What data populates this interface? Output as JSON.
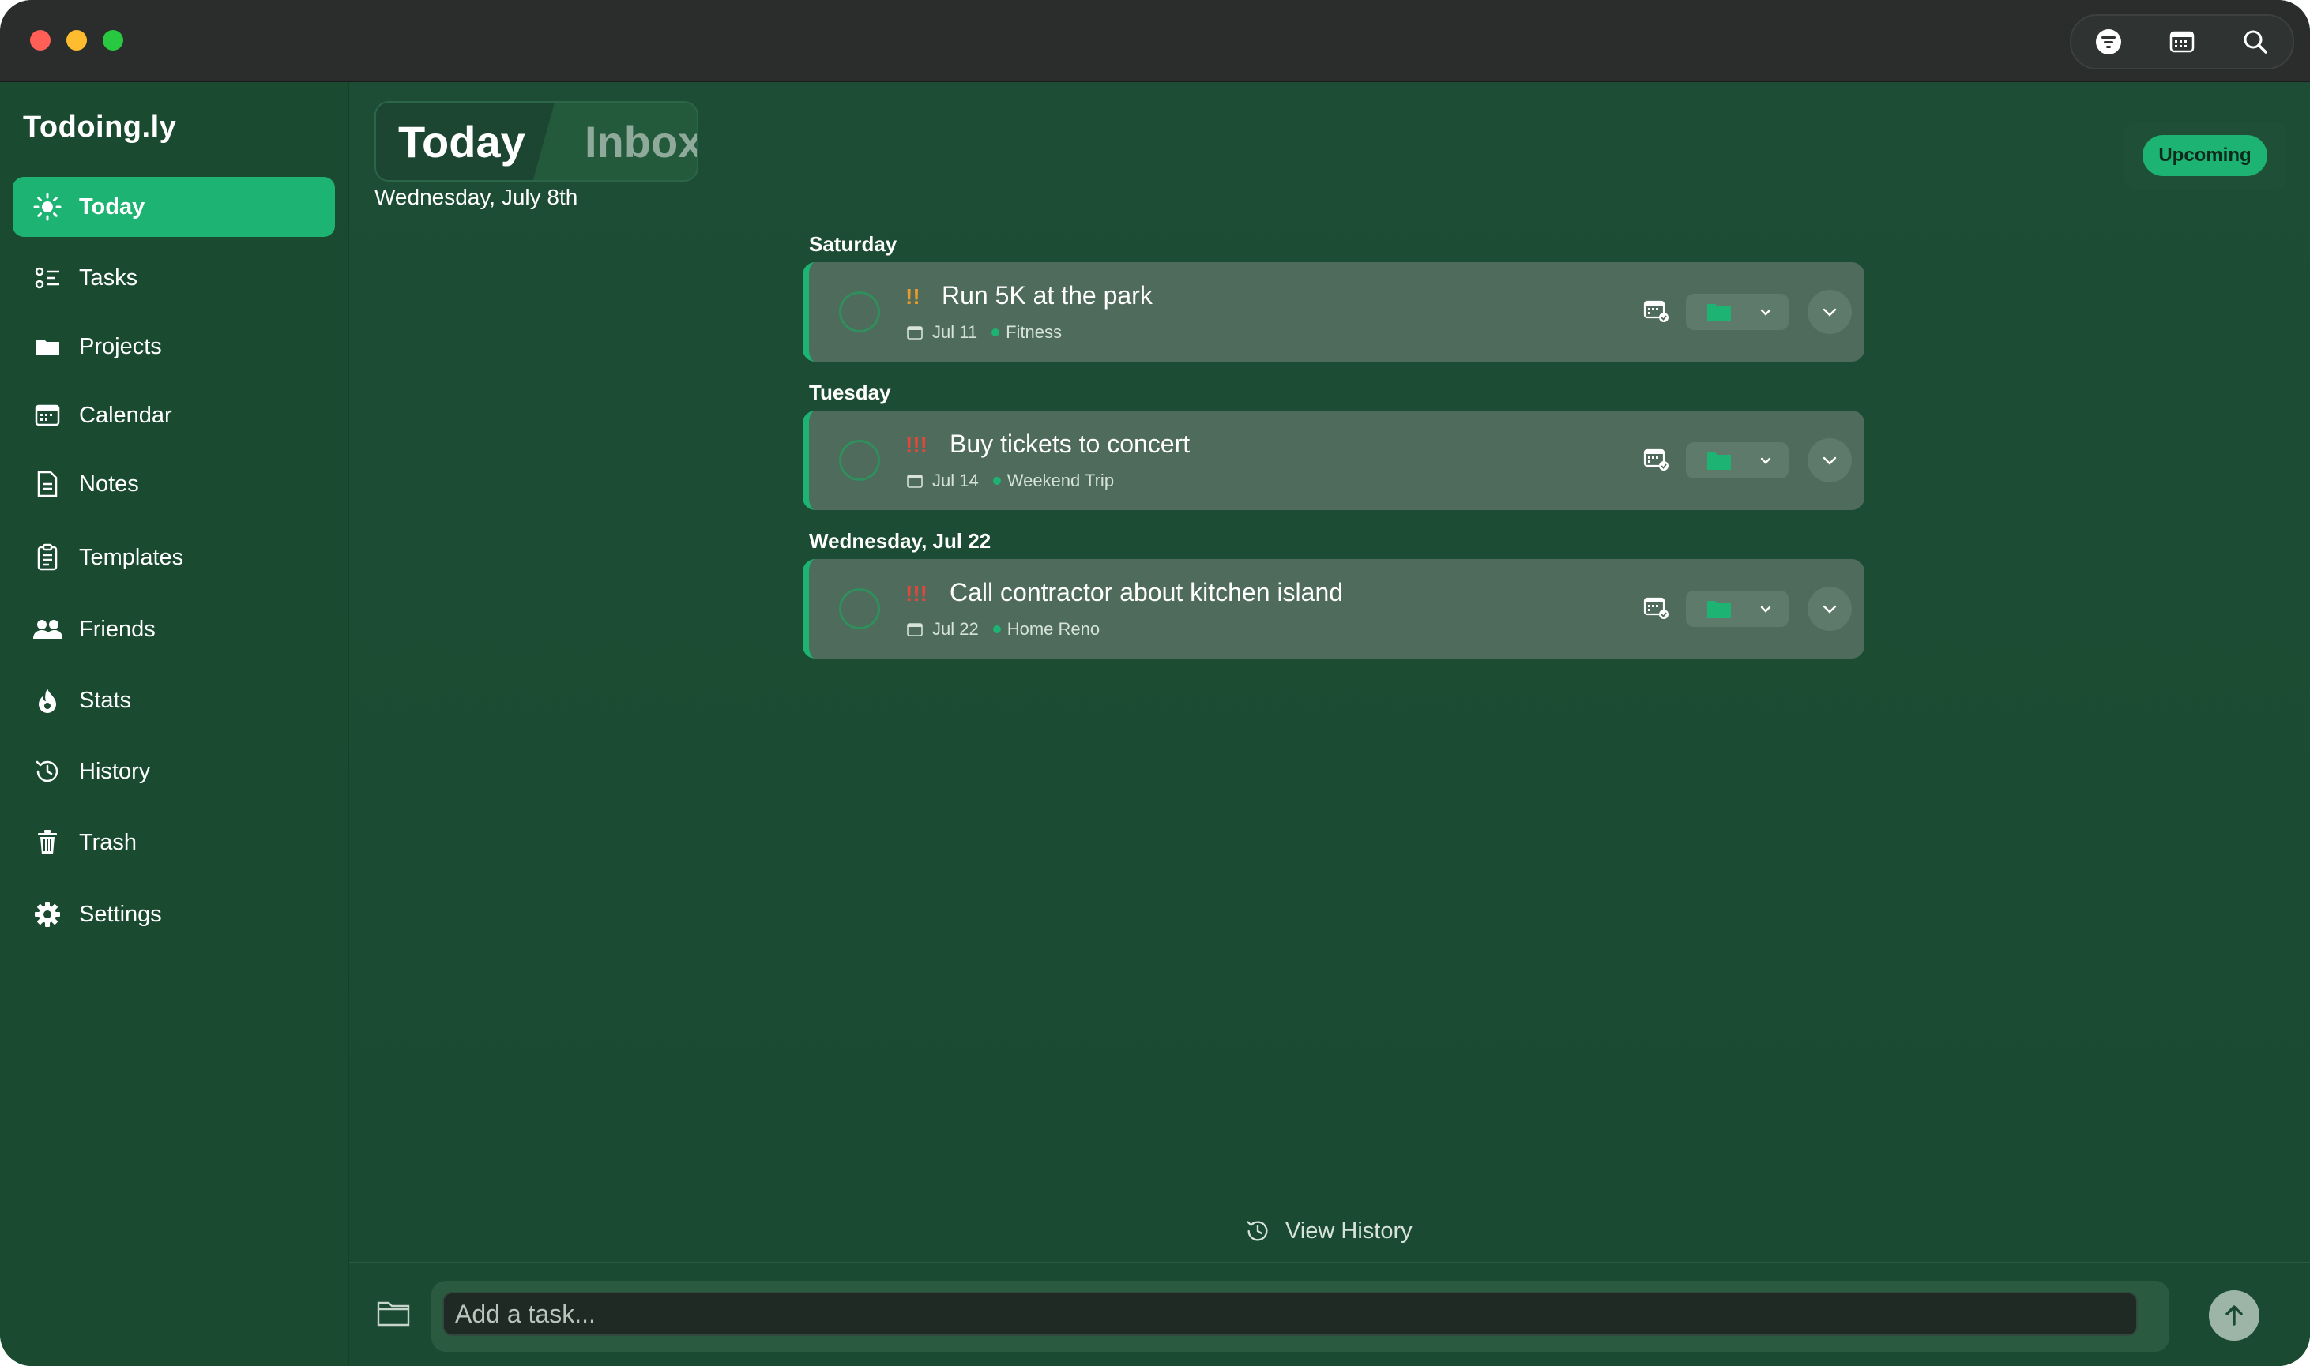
{
  "app": {
    "name": "Todoing.ly",
    "accent_color": "#1cb373",
    "priority_medium_color": "#e89a2a",
    "priority_high_color": "#e0483c"
  },
  "toolbar": {
    "icons": [
      "filter-icon",
      "calendar-grid-icon",
      "search-icon"
    ]
  },
  "sidebar": {
    "items": [
      {
        "label": "Today",
        "icon": "sun-icon",
        "active": true
      },
      {
        "label": "Tasks",
        "icon": "tasks-list-icon"
      },
      {
        "label": "Projects",
        "icon": "folder-icon"
      },
      {
        "label": "Calendar",
        "icon": "calendar-icon"
      },
      {
        "label": "Notes",
        "icon": "note-icon"
      },
      {
        "label": "Templates",
        "icon": "clipboard-icon"
      },
      {
        "label": "Friends",
        "icon": "people-icon"
      },
      {
        "label": "Stats",
        "icon": "flame-icon"
      },
      {
        "label": "History",
        "icon": "history-icon"
      },
      {
        "label": "Trash",
        "icon": "trash-icon"
      },
      {
        "label": "Settings",
        "icon": "gear-icon"
      }
    ]
  },
  "main": {
    "view_today": "Today",
    "view_inbox": "Inbox",
    "date": "Wednesday, July 8th",
    "upcoming_label": "Upcoming",
    "groups": [
      {
        "heading": "Saturday",
        "task": {
          "priority": "!!",
          "priority_level": "medium",
          "title": "Run 5K at the park",
          "due": "Jul 11",
          "project": "Fitness"
        }
      },
      {
        "heading": "Tuesday",
        "task": {
          "priority": "!!!",
          "priority_level": "high",
          "title": "Buy tickets to concert",
          "due": "Jul 14",
          "project": "Weekend Trip"
        }
      },
      {
        "heading": "Wednesday, Jul 22",
        "task": {
          "priority": "!!!",
          "priority_level": "high",
          "title": "Call contractor about kitchen island",
          "due": "Jul 22",
          "project": "Home Reno"
        }
      }
    ],
    "view_history_label": "View History"
  },
  "composer": {
    "placeholder": "Add a task..."
  }
}
